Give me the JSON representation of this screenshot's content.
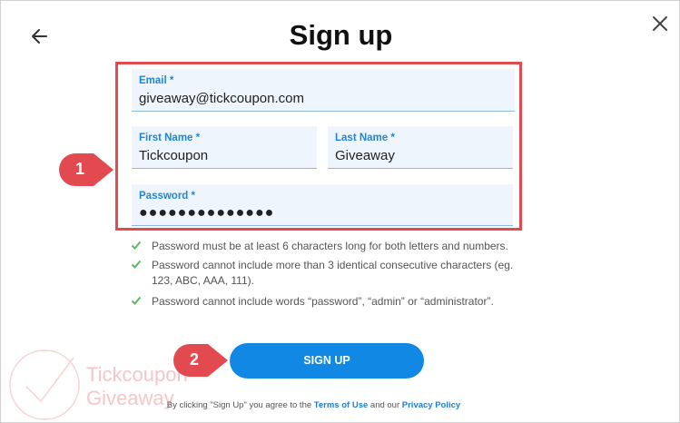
{
  "dialog": {
    "title": "Sign up"
  },
  "form": {
    "email": {
      "label": "Email *",
      "value": "giveaway@tickcoupon.com"
    },
    "first_name": {
      "label": "First Name *",
      "value": "Tickcoupon"
    },
    "last_name": {
      "label": "Last Name *",
      "value": "Giveaway"
    },
    "password": {
      "label": "Password *",
      "value": "●●●●●●●●●●●●●●"
    }
  },
  "password_rules": [
    {
      "text": "Password must be at least 6 characters long for both letters and numbers."
    },
    {
      "text": "Password cannot include more than 3 identical consecutive characters (eg. 123, ABC, AAA, 111)."
    },
    {
      "text": "Password cannot include words “password”, “admin” or “administrator”."
    }
  ],
  "callouts": {
    "one": "1",
    "two": "2"
  },
  "signup_button": {
    "label": "SIGN UP"
  },
  "terms": {
    "prefix": "By clicking \"Sign Up\" you agree to the ",
    "terms_link": "Terms of Use",
    "middle": " and our ",
    "privacy_link": "Privacy Policy"
  },
  "watermark": {
    "line1": "Tickcoupon",
    "line2": "Giveaway"
  },
  "colors": {
    "accent": "#1189e4",
    "label_blue": "#1e86d8",
    "highlight_red": "#e24a4f",
    "check_green": "#5cb85c",
    "field_bg": "#eef5fc"
  },
  "icons": {
    "back": "arrow-left-icon",
    "close": "close-icon",
    "check": "check-icon"
  }
}
